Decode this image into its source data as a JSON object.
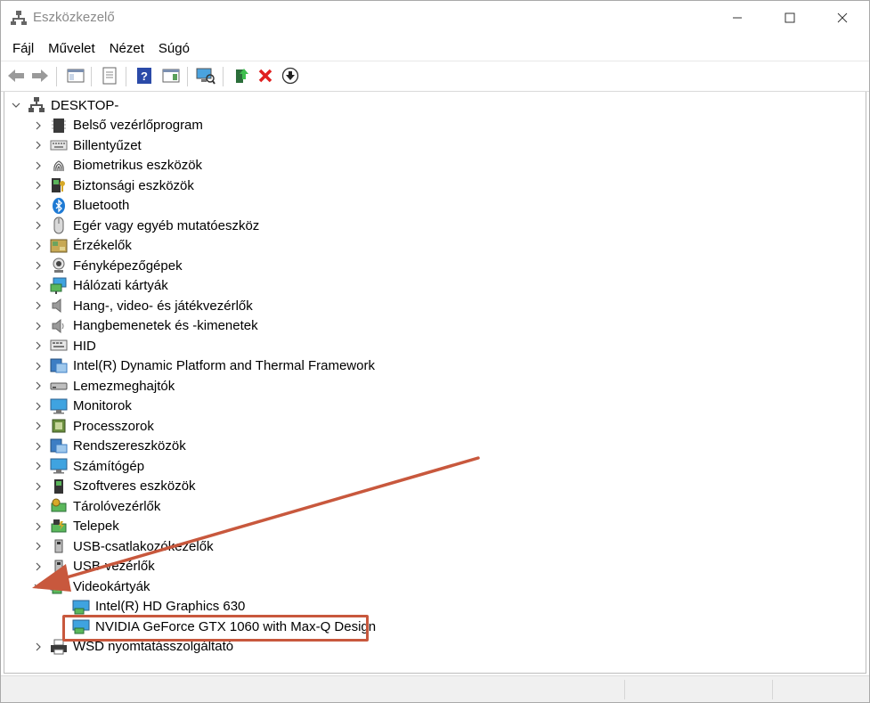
{
  "window": {
    "title": "Eszközkezelő"
  },
  "menu": [
    "Fájl",
    "Művelet",
    "Nézet",
    "Súgó"
  ],
  "toolbar_icons": [
    "back-icon",
    "forward-icon",
    "show-hide-console-tree-icon",
    "properties-icon",
    "help-icon",
    "action-pane-icon",
    "scan-hardware-icon",
    "update-driver-icon",
    "uninstall-icon",
    "disable-device-icon"
  ],
  "tree": {
    "root": "DESKTOP-",
    "categories": [
      {
        "label": "Belső vezérlőprogram",
        "icon": "firmware-icon"
      },
      {
        "label": "Billentyűzet",
        "icon": "keyboard-icon"
      },
      {
        "label": "Biometrikus eszközök",
        "icon": "fingerprint-icon"
      },
      {
        "label": "Biztonsági eszközök",
        "icon": "security-device-icon"
      },
      {
        "label": "Bluetooth",
        "icon": "bluetooth-icon"
      },
      {
        "label": "Egér vagy egyéb mutatóeszköz",
        "icon": "mouse-icon"
      },
      {
        "label": "Érzékelők",
        "icon": "sensor-icon"
      },
      {
        "label": "Fényképezőgépek",
        "icon": "camera-icon"
      },
      {
        "label": "Hálózati kártyák",
        "icon": "network-adapter-icon"
      },
      {
        "label": "Hang-, video- és játékvezérlők",
        "icon": "speaker-icon"
      },
      {
        "label": "Hangbemenetek és -kimenetek",
        "icon": "audio-io-icon"
      },
      {
        "label": "HID",
        "icon": "hid-icon"
      },
      {
        "label": "Intel(R) Dynamic Platform and Thermal Framework",
        "icon": "platform-icon"
      },
      {
        "label": "Lemezmeghajtók",
        "icon": "disk-drive-icon"
      },
      {
        "label": "Monitorok",
        "icon": "monitor-icon"
      },
      {
        "label": "Processzorok",
        "icon": "processor-icon"
      },
      {
        "label": "Rendszereszközök",
        "icon": "system-device-icon"
      },
      {
        "label": "Számítógép",
        "icon": "computer-icon"
      },
      {
        "label": "Szoftveres eszközök",
        "icon": "software-device-icon"
      },
      {
        "label": "Tárolóvezérlők",
        "icon": "storage-controller-icon"
      },
      {
        "label": "Telepek",
        "icon": "battery-icon"
      },
      {
        "label": "USB-csatlakozókezelők",
        "icon": "usb-connector-icon"
      },
      {
        "label": "USB-vezérlők",
        "icon": "usb-controller-icon"
      },
      {
        "label": "Videokártyák",
        "icon": "display-adapter-icon",
        "expanded": true,
        "children": [
          "Intel(R) HD Graphics 630",
          "NVIDIA GeForce GTX 1060 with Max-Q Design"
        ]
      },
      {
        "label": "WSD nyomtatásszolgáltató",
        "icon": "printer-icon"
      }
    ]
  },
  "colors": {
    "annotation": "#c8583d",
    "title_text": "#8a8a8a"
  }
}
